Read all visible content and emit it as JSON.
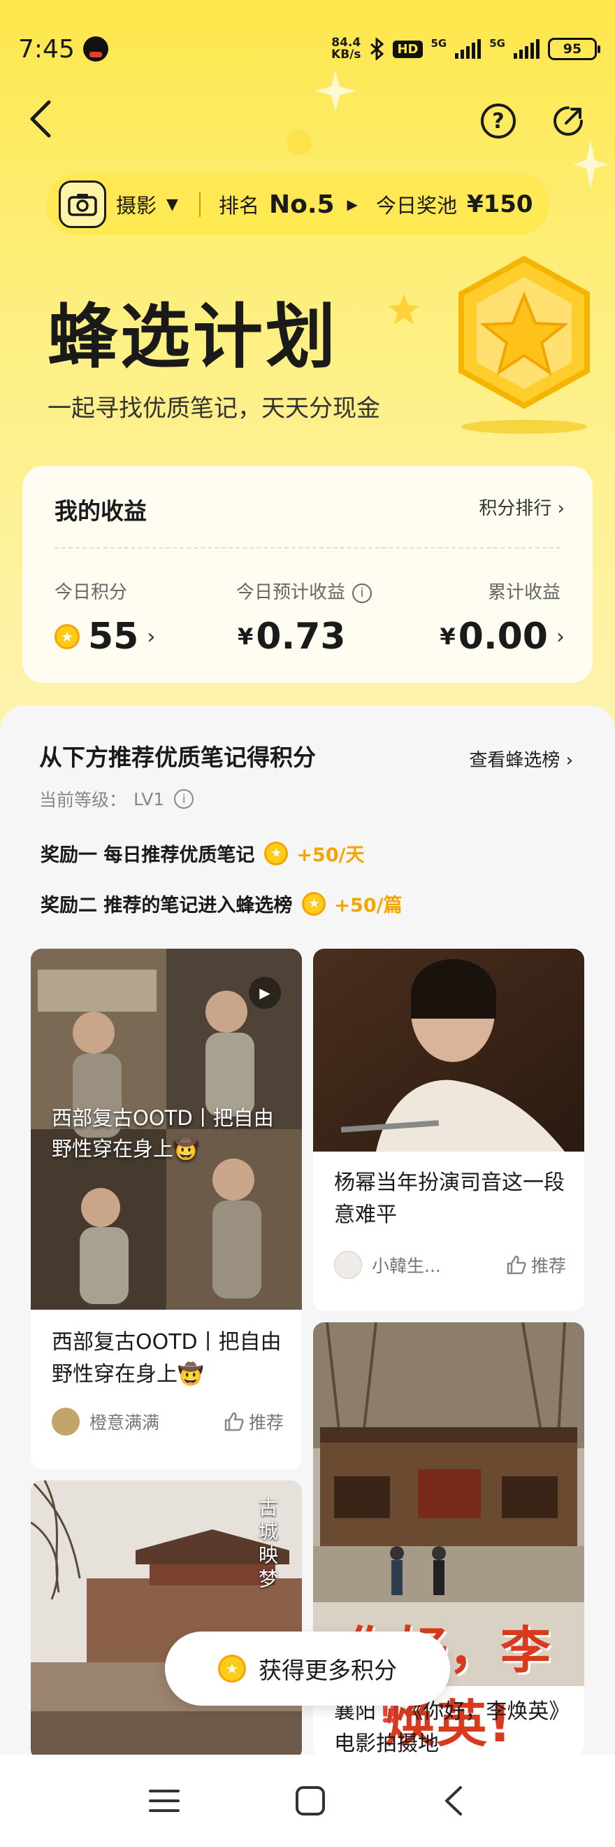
{
  "status_bar": {
    "time": "7:45",
    "net_speed_value": "84.4",
    "net_speed_unit": "KB/s",
    "hd_label": "HD",
    "sim1": "5G",
    "sim2": "5G",
    "battery": "95"
  },
  "header": {
    "category": "摄影",
    "rank_label": "排名",
    "rank_value": "No.5",
    "pool_label": "今日奖池",
    "pool_value": "¥150"
  },
  "hero": {
    "title": "蜂选计划",
    "subtitle": "一起寻找优质笔记，天天分现金"
  },
  "earnings": {
    "title": "我的收益",
    "rank_link": "积分排行",
    "today_points_label": "今日积分",
    "today_points": "55",
    "est_income_label": "今日预计收益",
    "est_income": "0.73",
    "total_income_label": "累计收益",
    "total_income": "0.00",
    "currency": "¥"
  },
  "recommend": {
    "title": "从下方推荐优质笔记得积分",
    "view_link": "查看蜂选榜",
    "level_label": "当前等级：",
    "level_value": "LV1",
    "rewards": [
      {
        "label": "奖励一   每日推荐优质笔记",
        "bonus": "+50/天"
      },
      {
        "label": "奖励二   推荐的笔记进入蜂选榜",
        "bonus": "+50/篇"
      }
    ]
  },
  "feed": [
    {
      "overlay": "西部复古OOTD丨把自由野性穿在身上🤠",
      "title": "西部复古OOTD丨把自由野性穿在身上🤠",
      "author": "橙意满满",
      "like_label": "推荐"
    },
    {
      "title": "杨幂当年扮演司音这一段 意难平",
      "author": "小韓生...",
      "like_label": "推荐"
    },
    {
      "poster_text": "你好，李焕英!",
      "title": "襄阳‼️《你好，李焕英》电影拍摄地"
    },
    {
      "poster_caption": "古城映梦"
    }
  ],
  "float_button": {
    "label": "获得更多积分"
  },
  "colors": {
    "accent": "#fde74c",
    "coin": "#ffcc1a",
    "bonus": "#f5a500"
  }
}
